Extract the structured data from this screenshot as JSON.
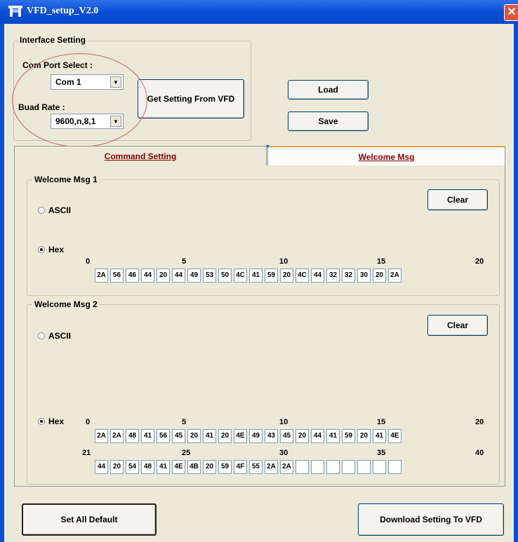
{
  "window": {
    "title": "VFD_setup_V2.0",
    "close_glyph": "✕"
  },
  "interface": {
    "group_label": "Interface Setting",
    "com_port_label": "Com Port Select :",
    "com_port_value": "Com 1",
    "baud_label": "Buad Rate :",
    "baud_value": "9600,n,8,1",
    "get_setting_button": "Get Setting From VFD"
  },
  "buttons": {
    "load": "Load",
    "save": "Save",
    "set_all_default": "Set All Default",
    "download": "Download Setting To VFD"
  },
  "tabs": [
    {
      "label": "Command Setting",
      "active": false
    },
    {
      "label": "Welcome Msg",
      "active": true
    }
  ],
  "msg1": {
    "label": "Welcome Msg 1",
    "clear": "Clear",
    "ascii_label": "ASCII",
    "hex_label": "Hex",
    "selected": "Hex",
    "ticks": [
      "0",
      "5",
      "10",
      "15",
      "20"
    ],
    "cells": [
      "2A",
      "56",
      "46",
      "44",
      "20",
      "44",
      "49",
      "53",
      "50",
      "4C",
      "41",
      "59",
      "20",
      "4C",
      "44",
      "32",
      "32",
      "30",
      "20",
      "2A"
    ]
  },
  "msg2": {
    "label": "Welcome Msg 2",
    "clear": "Clear",
    "ascii_label": "ASCII",
    "hex_label": "Hex",
    "selected": "Hex",
    "row1_ticks": [
      "0",
      "5",
      "10",
      "15",
      "20"
    ],
    "row1_cells": [
      "2A",
      "2A",
      "48",
      "41",
      "56",
      "45",
      "20",
      "41",
      "20",
      "4E",
      "49",
      "43",
      "45",
      "20",
      "44",
      "41",
      "59",
      "20",
      "41",
      "4E"
    ],
    "row2_ticks": [
      "21",
      "25",
      "30",
      "35",
      "40"
    ],
    "row2_cells": [
      "44",
      "20",
      "54",
      "48",
      "41",
      "4E",
      "4B",
      "20",
      "59",
      "4F",
      "55",
      "2A",
      "2A",
      "",
      "",
      "",
      "",
      "",
      "",
      ""
    ]
  },
  "colors": {
    "titlebar": "#0a4fd6",
    "tab_text": "#8b0000",
    "highlight": "#d06060"
  }
}
